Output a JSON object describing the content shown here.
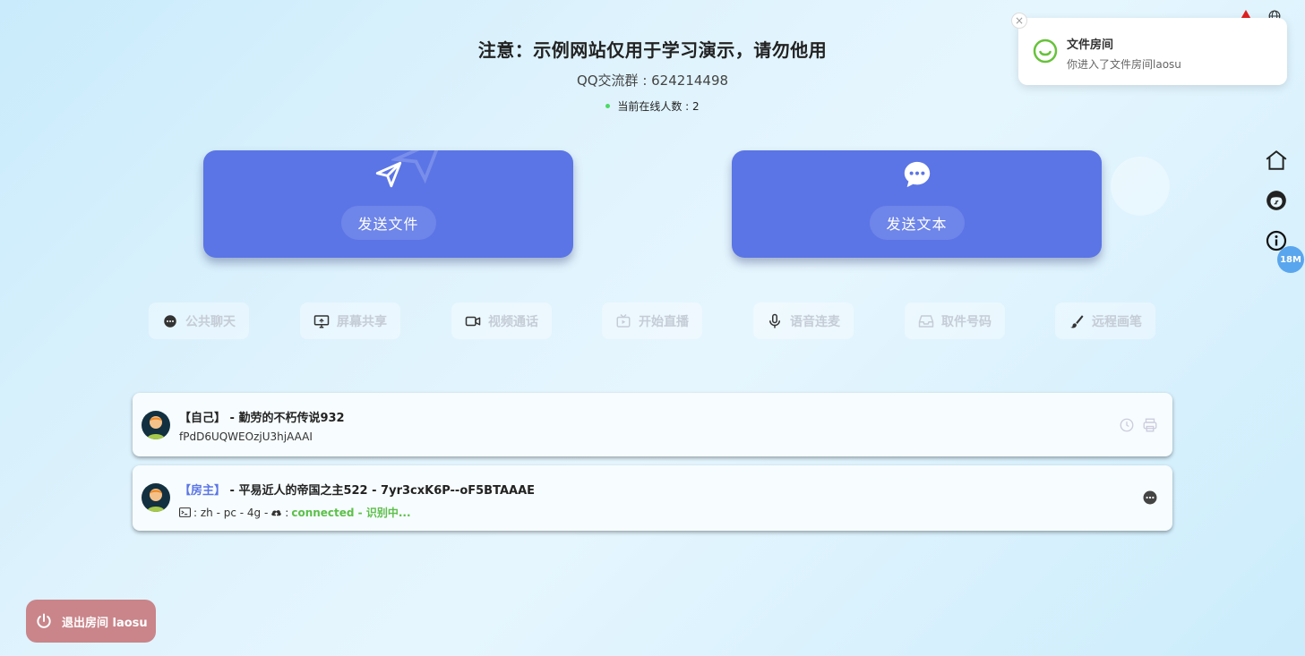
{
  "header": {
    "notice": "注意：示例网站仅用于学习演示，请勿他用",
    "qq_group": "QQ交流群 : 624214498",
    "online": "当前在线人数 : 2"
  },
  "actions": {
    "send_file": "发送文件",
    "send_text": "发送文本"
  },
  "features": [
    {
      "label": "公共聊天",
      "icon": "chat-bubble-icon"
    },
    {
      "label": "屏幕共享",
      "icon": "monitor-share-icon"
    },
    {
      "label": "视频通话",
      "icon": "video-camera-icon"
    },
    {
      "label": "开始直播",
      "icon": "tv-live-icon"
    },
    {
      "label": "语音连麦",
      "icon": "microphone-icon"
    },
    {
      "label": "取件号码",
      "icon": "inbox-icon"
    },
    {
      "label": "远程画笔",
      "icon": "brush-icon"
    }
  ],
  "users": [
    {
      "tag": "【自己】",
      "sep": " - ",
      "name": "勤劳的不朽传说932",
      "id": "fPdD6UQWEOzjU3hjAAAI"
    },
    {
      "tag": "【房主】",
      "sep": " - ",
      "name": "平易近人的帝国之主522 - 7yr3cxK6P--oF5BTAAAE",
      "info": " : zh - pc - 4g - ",
      "status_sep": " : ",
      "status": "connected - 识别中..."
    }
  ],
  "toast": {
    "title": "文件房间",
    "message": "你进入了文件房间laosu",
    "close": "×"
  },
  "badge": "18M",
  "exit_button": "退出房间 laosu",
  "colors": {
    "primary": "#5b75e6",
    "success": "#5cc04a",
    "exit": "#c9858a",
    "badge": "#5aa6ee"
  }
}
